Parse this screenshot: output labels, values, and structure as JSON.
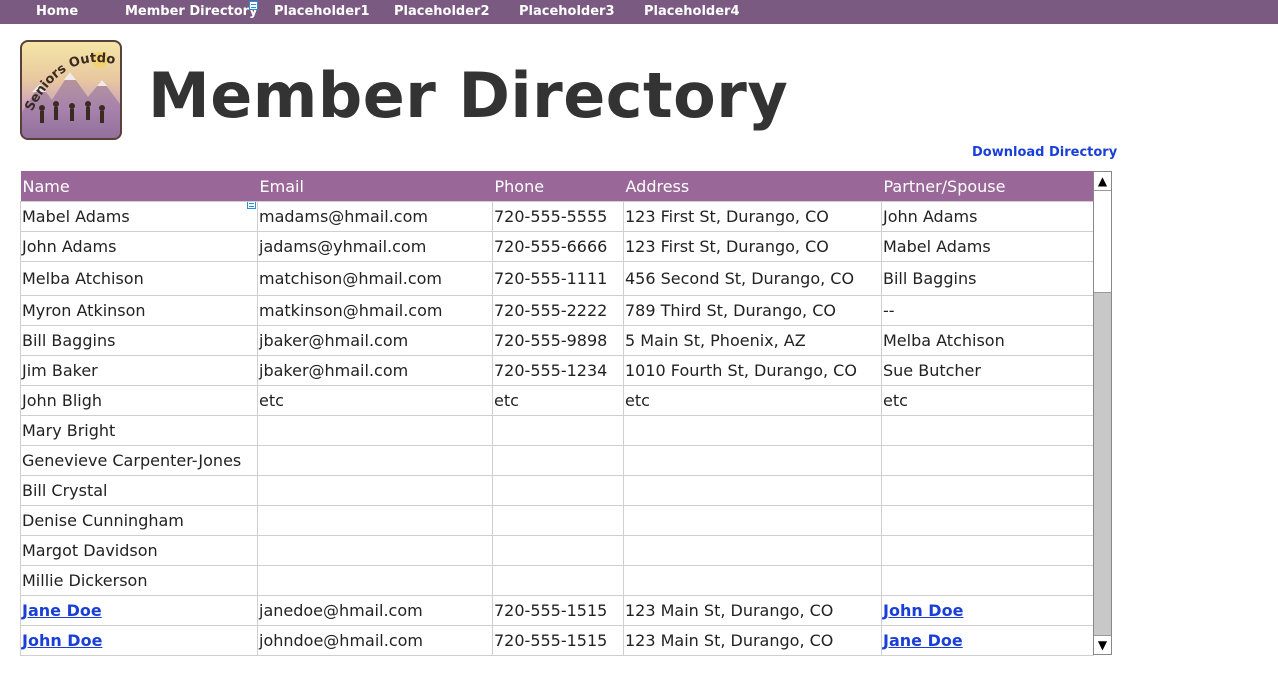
{
  "nav": {
    "items": [
      {
        "label": "Home"
      },
      {
        "label": "Member Directory"
      },
      {
        "label": "Placeholder1"
      },
      {
        "label": "Placeholder2"
      },
      {
        "label": "Placeholder3"
      },
      {
        "label": "Placeholder4"
      }
    ]
  },
  "logo": {
    "text": "Seniors Outdoors!",
    "icon": "hikers-logo"
  },
  "page": {
    "title": "Member Directory",
    "download_label": "Download Directory"
  },
  "table": {
    "headers": [
      "Name",
      "Email",
      "Phone",
      "Address",
      "Partner/Spouse"
    ],
    "rows": [
      {
        "name": "Mabel Adams",
        "email": "madams@hmail.com",
        "phone": "720-555-5555",
        "address": "123 First St, Durango, CO",
        "partner": "John Adams"
      },
      {
        "name": "John Adams",
        "email": "jadams@yhmail.com",
        "phone": "720-555-6666",
        "address": "123 First St, Durango, CO",
        "partner": "Mabel Adams"
      },
      {
        "name": "Melba Atchison",
        "email": "matchison@hmail.com",
        "phone": "720-555-1111",
        "address": "456 Second St, Durango, CO",
        "partner": "Bill Baggins"
      },
      {
        "name": "Myron Atkinson",
        "email": "matkinson@hmail.com",
        "phone": "720-555-2222",
        "address": "789 Third St, Durango, CO",
        "partner": "--"
      },
      {
        "name": "Bill Baggins",
        "email": "jbaker@hmail.com",
        "phone": "720-555-9898",
        "address": "5 Main St, Phoenix, AZ",
        "partner": "Melba Atchison"
      },
      {
        "name": "Jim Baker",
        "email": "jbaker@hmail.com",
        "phone": "720-555-1234",
        "address": "1010 Fourth St, Durango, CO",
        "partner": "Sue Butcher"
      },
      {
        "name": "John Bligh",
        "email": "etc",
        "phone": "etc",
        "address": "etc",
        "partner": "etc"
      },
      {
        "name": "Mary Bright",
        "email": "",
        "phone": "",
        "address": "",
        "partner": ""
      },
      {
        "name": "Genevieve Carpenter-Jones",
        "email": "",
        "phone": "",
        "address": "",
        "partner": ""
      },
      {
        "name": "Bill Crystal",
        "email": "",
        "phone": "",
        "address": "",
        "partner": ""
      },
      {
        "name": "Denise Cunningham",
        "email": "",
        "phone": "",
        "address": "",
        "partner": ""
      },
      {
        "name": "Margot Davidson",
        "email": "",
        "phone": "",
        "address": "",
        "partner": ""
      },
      {
        "name": "Millie Dickerson",
        "email": "",
        "phone": "",
        "address": "",
        "partner": ""
      },
      {
        "name": "Jane Doe",
        "email": "janedoe@hmail.com",
        "phone": "720-555-1515",
        "address": "123 Main St, Durango, CO",
        "partner": "John Doe"
      },
      {
        "name": "John Doe",
        "email": "johndoe@hmail.com",
        "phone": "720-555-1515",
        "address": "123 Main St, Durango, CO",
        "partner": "Jane Doe"
      }
    ]
  },
  "scrollbar": {
    "up_icon": "▲",
    "down_icon": "▼"
  },
  "colors": {
    "nav_bg": "#7b5a82",
    "header_bg": "#9a6799",
    "link": "#1a3fd6",
    "title": "#333333"
  }
}
